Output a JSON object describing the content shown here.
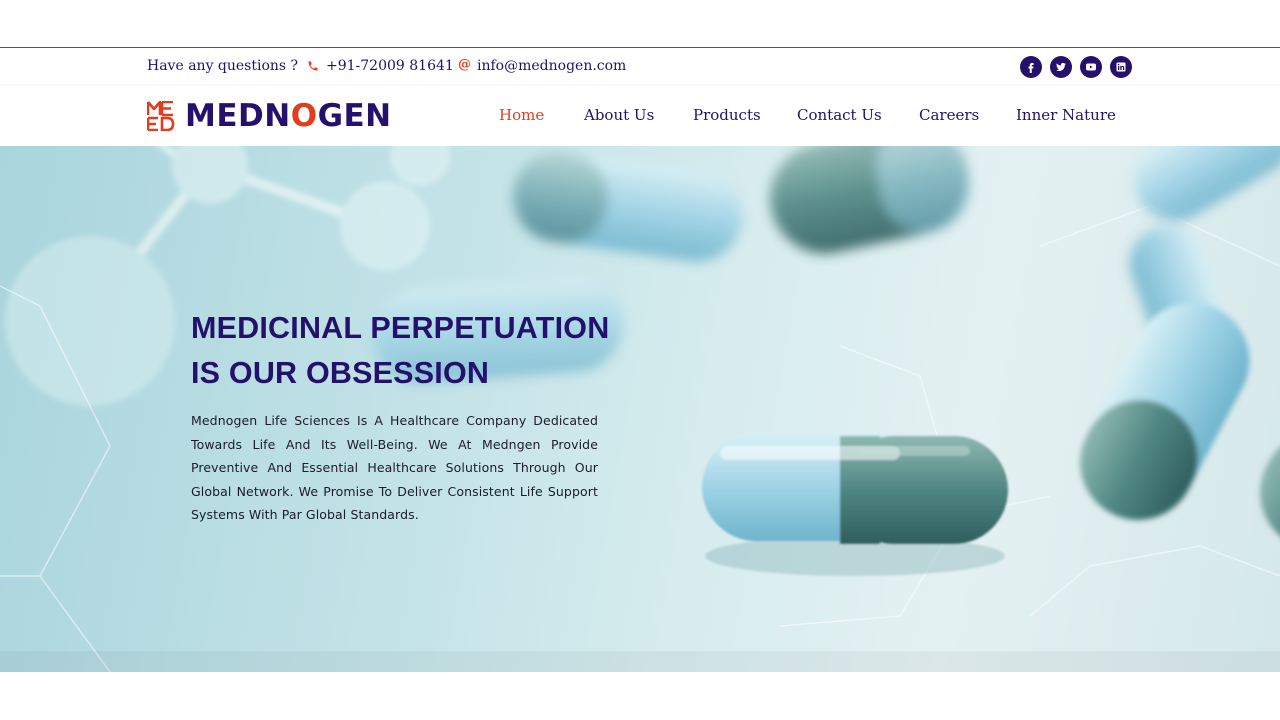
{
  "topbar": {
    "question": "Have any questions ?",
    "phone": "+91-72009 81641",
    "email_symbol": "@",
    "email": "info@mednogen.com",
    "social": [
      {
        "icon": "facebook-icon",
        "label": "f"
      },
      {
        "icon": "twitter-icon"
      },
      {
        "icon": "youtube-icon"
      },
      {
        "icon": "linkedin-icon",
        "label": "in"
      }
    ]
  },
  "brand": {
    "name_part1": "MEDN",
    "name_o": "O",
    "name_part2": "GEN",
    "mark_letters": "ME D",
    "colors": {
      "primary": "#24116b",
      "accent": "#e23d1c"
    }
  },
  "nav": {
    "items": [
      {
        "label": "Home",
        "active": true
      },
      {
        "label": "About Us"
      },
      {
        "label": "Products"
      },
      {
        "label": "Contact Us"
      },
      {
        "label": "Careers"
      },
      {
        "label": "Inner Nature"
      }
    ]
  },
  "hero": {
    "title_line1": "MEDICINAL PERPETUATION",
    "title_line2": "IS OUR OBSESSION",
    "description": "Mednogen Life Sciences Is A Healthcare Company Dedicated Towards Life And Its Well-Being. We At Medngen Provide Preventive And Essential Healthcare Solutions Through Our Global Network. We Promise To Deliver Consistent Life Support Systems With Par Global Standards."
  }
}
